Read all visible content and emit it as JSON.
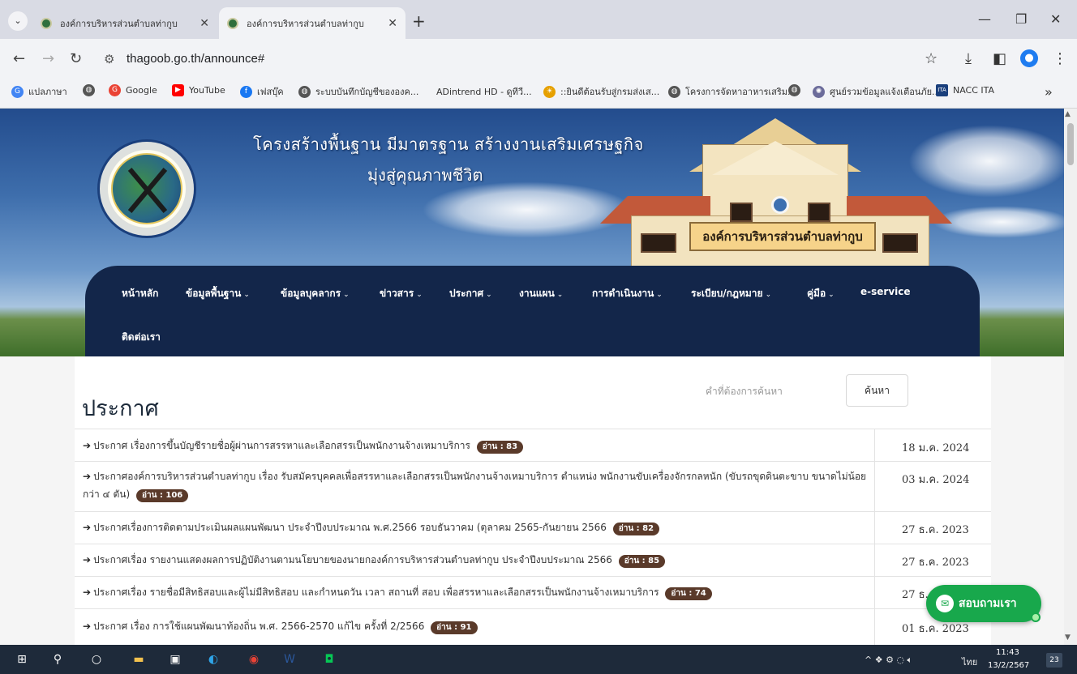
{
  "browser": {
    "tabs": [
      {
        "label": "องค์การบริหารส่วนตำบลท่ากูบ",
        "active": false
      },
      {
        "label": "องค์การบริหารส่วนตำบลท่ากูบ",
        "active": true
      }
    ],
    "url": "thagoob.go.th/announce#",
    "bookmarks": [
      {
        "label": "แปลภาษา",
        "icon": "translate-icon",
        "color": "#4285f4"
      },
      {
        "label": "",
        "icon": "globe-icon",
        "color": "#555555"
      },
      {
        "label": "Google",
        "icon": "google-icon",
        "color": "#ea4335"
      },
      {
        "label": "YouTube",
        "icon": "youtube-icon",
        "color": "#ff0000"
      },
      {
        "label": "เฟสบุ๊ค",
        "icon": "facebook-icon",
        "color": "#1877f2"
      },
      {
        "label": "ระบบบันทึกบัญชีขององค...",
        "icon": "globe-icon",
        "color": "#555555"
      },
      {
        "label": "ADintrend HD - ดูทีวี...",
        "icon": "",
        "color": ""
      },
      {
        "label": "::ยินดีต้อนรับสู่กรมส่งเส...",
        "icon": "sun-icon",
        "color": "#e6a000"
      },
      {
        "label": "โครงการจัดหาอาหารเสริม...",
        "icon": "globe-icon",
        "color": "#555555"
      },
      {
        "label": "",
        "icon": "globe-icon",
        "color": "#555555"
      },
      {
        "label": "ศูนย์รวมข้อมูลแจ้งเตือนภัย...",
        "icon": "emblem-icon",
        "color": "#6b6b9a"
      },
      {
        "label": "NACC ITA",
        "icon": "nacc-icon",
        "color": "#1a3f7c"
      }
    ]
  },
  "hero": {
    "title": "โครงสร้างพื้นฐาน มีมาตรฐาน สร้างงานเสริมเศรษฐกิจ",
    "subtitle": "มุ่งสู่คุณภาพชีวิต",
    "building_sign": "องค์การบริหารส่วนตำบลท่ากูบ"
  },
  "nav": {
    "items": [
      {
        "label": "หน้าหลัก",
        "dropdown": false
      },
      {
        "label": "ข้อมูลพื้นฐาน",
        "dropdown": true
      },
      {
        "label": "ข้อมูลบุคลากร",
        "dropdown": true
      },
      {
        "label": "ข่าวสาร",
        "dropdown": true
      },
      {
        "label": "ประกาศ",
        "dropdown": true
      },
      {
        "label": "งานแผน",
        "dropdown": true
      },
      {
        "label": "การดำเนินงาน",
        "dropdown": true
      },
      {
        "label": "ระเบียบ/กฎหมาย",
        "dropdown": true
      },
      {
        "label": "คู่มือ",
        "dropdown": true
      },
      {
        "label": "e-service",
        "dropdown": false
      },
      {
        "label": "ติดต่อเรา",
        "dropdown": false
      }
    ]
  },
  "page": {
    "title": "ประกาศ",
    "search_placeholder": "คำที่ต้องการค้นหา",
    "search_button": "ค้นหา"
  },
  "announcements": [
    {
      "title": "ประกาศ เรื่องการขึ้นบัญชีรายชื่อผู้ผ่านการสรรหาและเลือกสรรเป็นพนักงานจ้างเหมาบริการ",
      "views": "อ่าน : 83",
      "date": "18 ม.ค. 2024"
    },
    {
      "title": "ประกาศองค์การบริหารส่วนตำบลท่ากูบ เรื่อง รับสมัครบุคคลเพื่อสรรหาและเลือกสรรเป็นพนักงานจ้างเหมาบริการ ตำแหน่ง พนักงานขับเครื่องจักรกลหนัก (ขับรถขุดดินตะขาบ ขนาดไม่น้อยกว่า ๔ ตัน)",
      "views": "อ่าน : 106",
      "date": "03 ม.ค. 2024"
    },
    {
      "title": "ประกาศเรื่องการติดตามประเมินผลแผนพัฒนา ประจำปีงบประมาณ พ.ศ.2566 รอบธันวาคม (ตุลาคม 2565-กันยายน 2566",
      "views": "อ่าน : 82",
      "date": "27 ธ.ค. 2023"
    },
    {
      "title": "ประกาศเรื่อง รายงานแสดงผลการปฏิบัติงานตามนโยบายของนายกองค์การบริหารส่วนตำบลท่ากูบ ประจำปีงบประมาณ 2566",
      "views": "อ่าน : 85",
      "date": "27 ธ.ค. 2023"
    },
    {
      "title": "ประกาศเรื่อง รายชื่อมีสิทธิสอบและผู้ไม่มีสิทธิสอบ และกำหนดวัน เวลา สถานที่ สอบ เพื่อสรรหาและเลือกสรรเป็นพนักงานจ้างเหมาบริการ",
      "views": "อ่าน : 74",
      "date": "27 ธ."
    },
    {
      "title": "ประกาศ เรื่อง การใช้แผนพัฒนาท้องถิ่น พ.ศ. 2566-2570 แก้ไข ครั้งที่ 2/2566",
      "views": "อ่าน : 91",
      "date": "01 ธ.ค. 2023"
    }
  ],
  "chat": {
    "label": "สอบถามเรา"
  },
  "taskbar": {
    "time": "11:43",
    "date": "13/2/2567",
    "lang": "ไทย",
    "notifications": "23"
  },
  "colors": {
    "nav_bg": "#13264a",
    "badge_bg": "#5a3a2a",
    "chat_bg": "#18a84c",
    "taskbar_bg": "#1e2a3a"
  }
}
